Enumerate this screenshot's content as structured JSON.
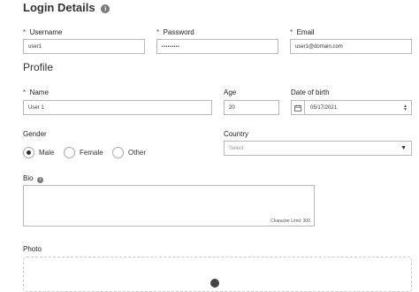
{
  "login": {
    "heading": "Login Details",
    "info_icon": "info-icon",
    "username": {
      "label": "Username",
      "value": "user1"
    },
    "password": {
      "label": "Password",
      "value": "•••••••••"
    },
    "email": {
      "label": "Email",
      "value": "user1@domain.com"
    }
  },
  "profile": {
    "heading": "Profile",
    "name": {
      "label": "Name",
      "value": "User 1"
    },
    "age": {
      "label": "Age",
      "value": "20"
    },
    "dob": {
      "label": "Date of birth",
      "value": "05/17/2021",
      "icon": "calendar-icon",
      "spinner_icon": "spinner-icon"
    },
    "gender": {
      "label": "Gender",
      "options": [
        "Male",
        "Female",
        "Other"
      ],
      "selected": "Male"
    },
    "country": {
      "label": "Country",
      "placeholder": "Select",
      "icon": "caret-down-icon"
    },
    "bio": {
      "label": "Bio",
      "info_icon": "info-icon",
      "char_limit": "Character Limit: 300"
    },
    "photo": {
      "label": "Photo"
    }
  },
  "colors": {
    "required": "#d02020",
    "border": "#b8b8b8"
  }
}
